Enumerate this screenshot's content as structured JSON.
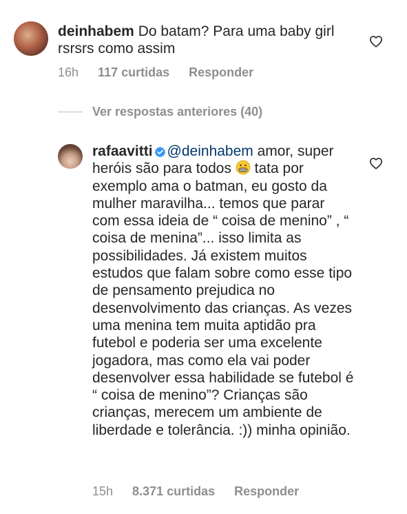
{
  "comment_main": {
    "username": "deinhabem",
    "text": " Do batam? Para uma baby girl rsrsrs como assim",
    "time": "16h",
    "likes": "117 curtidas",
    "reply_label": "Responder"
  },
  "replies_toggle": {
    "label": "Ver respostas anteriores (40)"
  },
  "reply": {
    "username": "rafaavitti",
    "mention": "@deinhabem",
    "text_part1": " amor, super heróis são para todos",
    "text_part2": " tata por exemplo ama o batman, eu gosto da mulher maravilha... temos que parar com essa ideia de “ coisa de menino” , “ coisa de menina”... isso limita as possibilidades. Já existem muitos estudos que falam sobre como esse tipo de pensamento prejudica no desenvolvimento das crianças. As vezes uma menina tem muita aptidão pra futebol e poderia ser uma excelente jogadora, mas como ela vai poder desenvolver essa habilidade se futebol  é “ coisa de menino”? Crianças são crianças, merecem um ambiente de liberdade e tolerância. :)) minha opinião.",
    "time": "15h",
    "likes": "8.371 curtidas",
    "reply_label": "Responder"
  },
  "colors": {
    "text": "#262626",
    "meta": "#8e8e8e",
    "mention": "#00376b",
    "verified": "#3897f0"
  },
  "icons": [
    "heart-icon",
    "verified-badge-icon",
    "grimacing-emoji"
  ]
}
